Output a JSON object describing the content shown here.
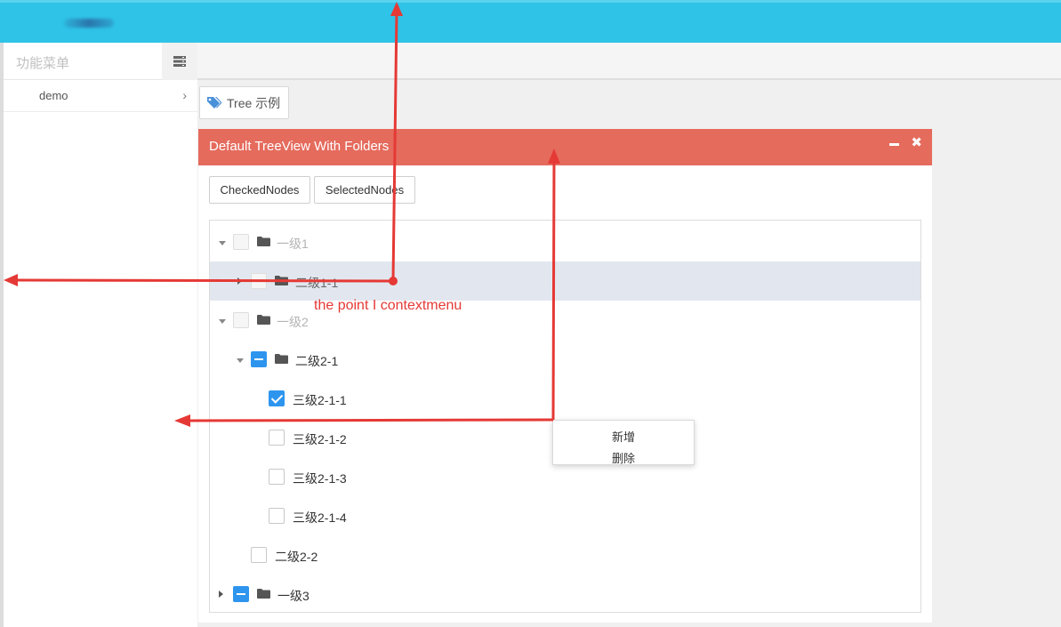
{
  "sidebar": {
    "title": "功能菜单",
    "items": [
      {
        "label": "demo",
        "chevron": "›"
      }
    ]
  },
  "page_tab": {
    "icon": "tags-icon",
    "label": "Tree 示例"
  },
  "panel": {
    "title": "Default TreeView With Folders",
    "close_glyph": "✖"
  },
  "buttons": {
    "checked_nodes": "CheckedNodes",
    "selected_nodes": "SelectedNodes"
  },
  "tree": {
    "nodes": [
      {
        "label": "一级1",
        "state": "disabled",
        "expanded": true
      },
      {
        "label": "二级1-1",
        "state": "disabled",
        "expanded": false,
        "selected": true
      },
      {
        "label": "一级2",
        "state": "disabled",
        "expanded": true
      },
      {
        "label": "二级2-1",
        "state": "partial",
        "expanded": true
      },
      {
        "label": "三级2-1-1",
        "state": "checked"
      },
      {
        "label": "三级2-1-2",
        "state": "unchecked"
      },
      {
        "label": "三级2-1-3",
        "state": "unchecked"
      },
      {
        "label": "三级2-1-4",
        "state": "unchecked"
      },
      {
        "label": "二级2-2",
        "state": "unchecked"
      },
      {
        "label": "一级3",
        "state": "partial",
        "expanded": false
      }
    ]
  },
  "context_menu": {
    "items": [
      "新增",
      "删除"
    ]
  },
  "annotation": {
    "text": "the point I contextmenu"
  },
  "colors": {
    "topbar": "#2fc3e8",
    "panel_header": "#e56b5d",
    "checkbox_blue": "#2d95ee",
    "selected_row": "#e2e7ef",
    "annotation_red": "#e53935"
  }
}
